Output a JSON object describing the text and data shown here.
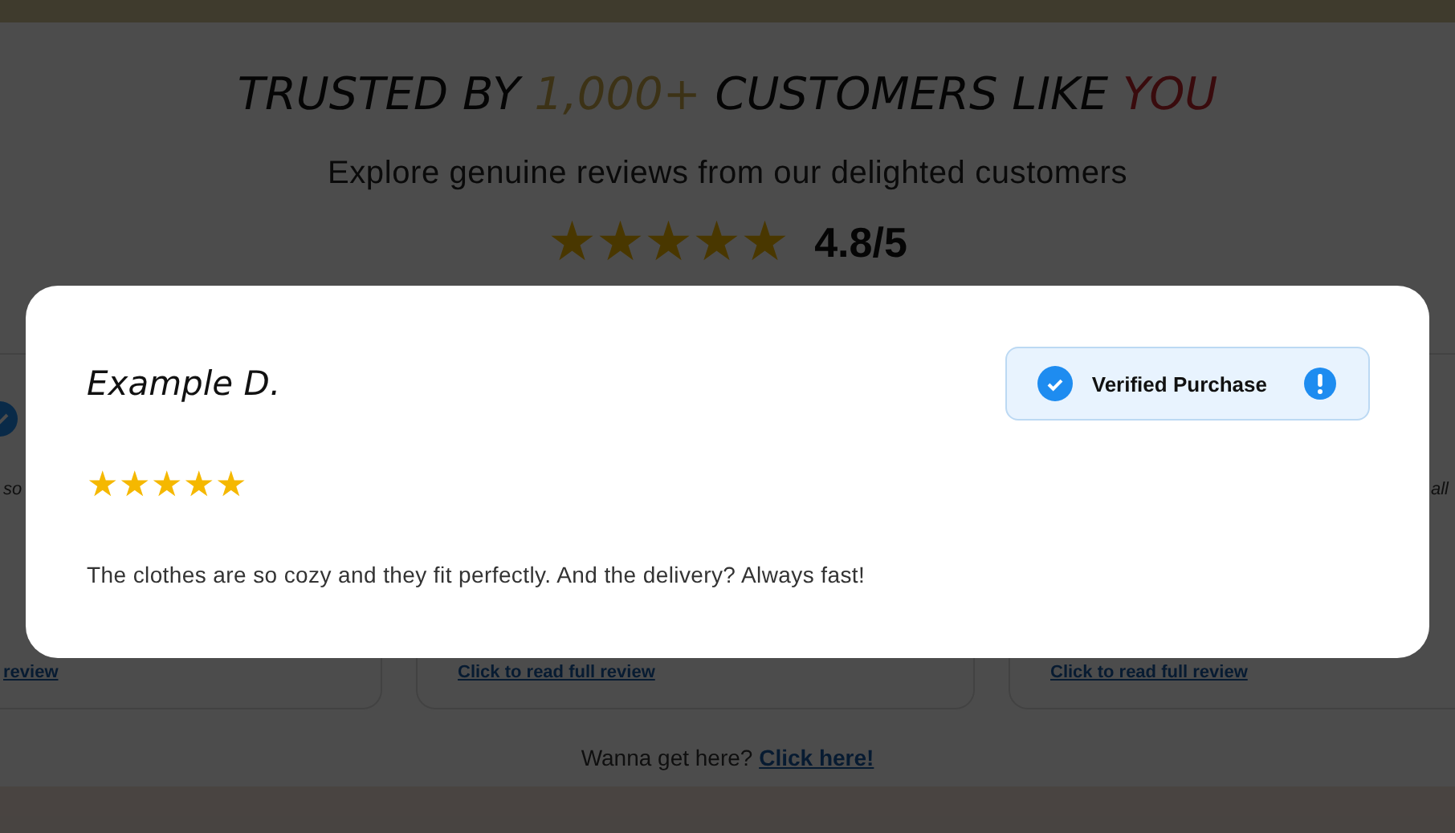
{
  "heading": {
    "parts": [
      {
        "text": "TRUSTED BY ",
        "kind": "plain"
      },
      {
        "text": "1,000+",
        "kind": "gold"
      },
      {
        "text": " CUSTOMERS LIKE ",
        "kind": "plain"
      },
      {
        "text": "YOU",
        "kind": "red"
      }
    ]
  },
  "subtitle": "Explore genuine reviews from our delighted customers",
  "rating": {
    "stars": 5,
    "score": "4.8/5"
  },
  "cards": [
    {
      "snippet": "so",
      "link": "review",
      "verified": true
    },
    {
      "link": "Click to read full review"
    },
    {
      "snippet": "all",
      "link": "Click to read full review"
    }
  ],
  "footer": {
    "text": "Wanna get here?",
    "link": "Click here!"
  },
  "modal": {
    "name": "Example D.",
    "badge": "Verified Purchase",
    "stars": 5,
    "review": "The clothes are so cozy and they fit perfectly. And the delivery? Always fast!"
  }
}
